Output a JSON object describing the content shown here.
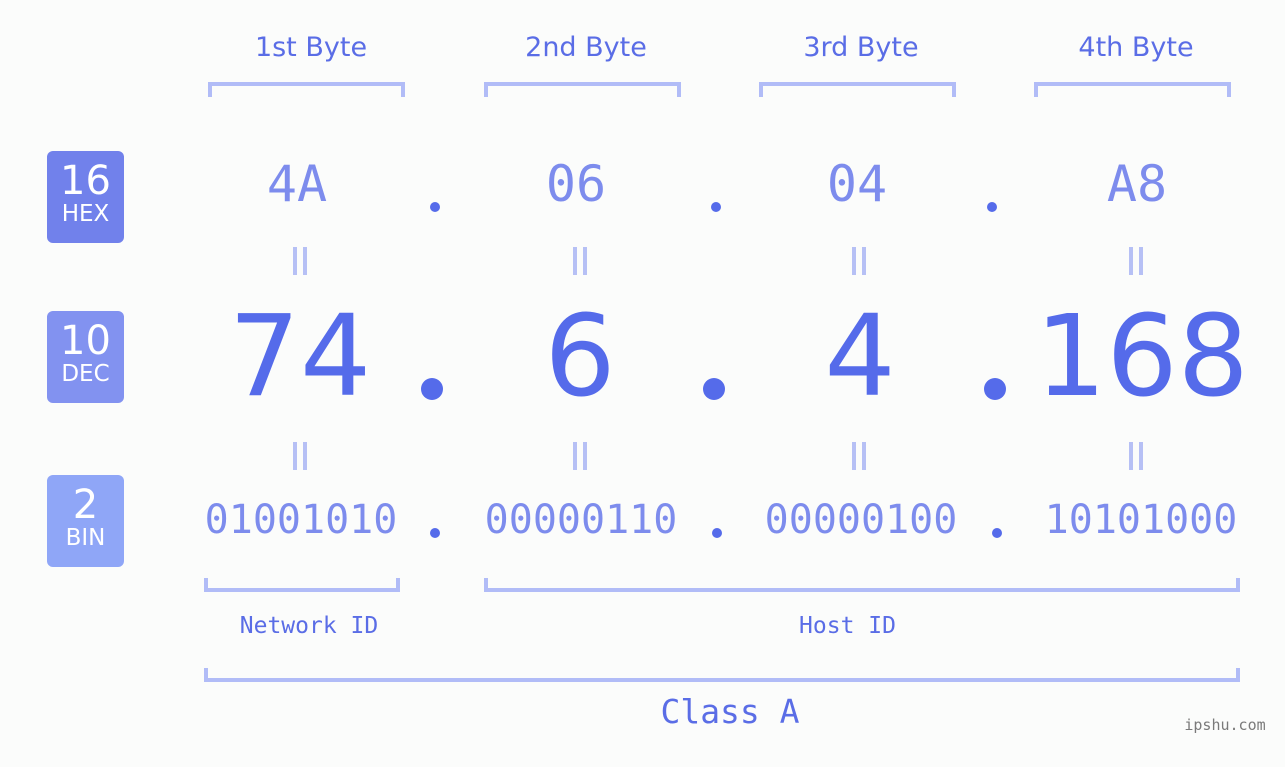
{
  "bytes": {
    "labels": [
      "1st Byte",
      "2nd Byte",
      "3rd Byte",
      "4th Byte"
    ],
    "hex": [
      "4A",
      "06",
      "04",
      "A8"
    ],
    "dec": [
      "74",
      "6",
      "4",
      "168"
    ],
    "bin": [
      "01001010",
      "00000110",
      "00000100",
      "10101000"
    ]
  },
  "badges": {
    "hex": {
      "num": "16",
      "unit": "HEX",
      "color": "#7181eb"
    },
    "dec": {
      "num": "10",
      "unit": "DEC",
      "color": "#8292f0"
    },
    "bin": {
      "num": "2",
      "unit": "BIN",
      "color": "#8fa6f7"
    }
  },
  "separator": ".",
  "ids": {
    "network": "Network ID",
    "host": "Host ID"
  },
  "class_label": "Class A",
  "watermark": "ipshu.com",
  "colors": {
    "accent": "#556bea",
    "light": "#7d8ced",
    "bracket": "#b1bcf7"
  }
}
